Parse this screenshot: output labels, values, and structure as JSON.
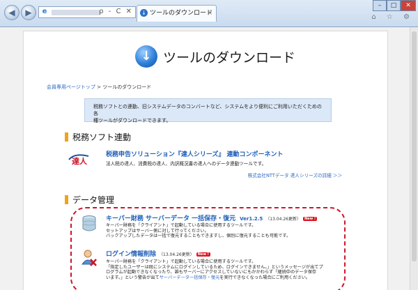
{
  "browser": {
    "address_controls": "ρ - C ✕",
    "tab_title": "ツールのダウンロード",
    "tab_close": "×",
    "toolbar_icons": "⌂ ☆ ⚙"
  },
  "page": {
    "title": "ツールのダウンロード",
    "breadcrumb": {
      "link": "会員専用ページトップ",
      "separator": " > ",
      "current": "ツールのダウンロード"
    },
    "intro": {
      "line1": "税務ソフトとの連動、旧システムデータのコンバートなど、システムをより便利にご利用いただくための各",
      "line2": "種ツールがダウンロードできます。"
    },
    "section1": {
      "heading": "税務ソフト連動",
      "logo_text": "達人",
      "item_title": "税務申告ソリューション『達人シリーズ』 連動コンポーネント",
      "item_desc": "法人税の達人、消費税の達人、内訳概況書の達人へのデータ連動ツールです。",
      "link": "株式会社NTTデータ 達人シリーズの詳細 ＞＞"
    },
    "section2": {
      "heading": "データ管理",
      "items": [
        {
          "title": "キーパー財務 サーバーデータ 一括保存・復元",
          "version": "Ver1.2.5",
          "date": "（13.04.26更新）",
          "badge": "New !",
          "desc": [
            "キーパー財務を「クライアント」で起動している場合に使用するツールです。",
            "セットアップはサーバー側に対して行ってください。",
            "バックアップしたデータは一括で復元することもできますし、個別に復元することも可能です。"
          ]
        },
        {
          "title": "ログイン情報削除",
          "date": "（13.04.26更新）",
          "badge": "New !",
          "desc": [
            "キーパー財務を「クライアント」で起動している場合に使用するツールです。",
            "「指定したユーザーは既にシステムにログインしているため、ログインできません。」というメッセージが出てプ",
            "ログラムが起動できなくなったり、誰もサーバーにアクセスしていないにもかかわらず「継続中のデータ保存",
            "います。」という警告が出て",
            "サーバーデータ一括保存・復元",
            "を実行できなくなった場合にご利用ください。"
          ]
        }
      ]
    }
  },
  "colors": {
    "accent": "#f0a31a",
    "link": "#2c67c4",
    "alert": "#d0142a",
    "intro_bg": "#dbe8f7"
  }
}
